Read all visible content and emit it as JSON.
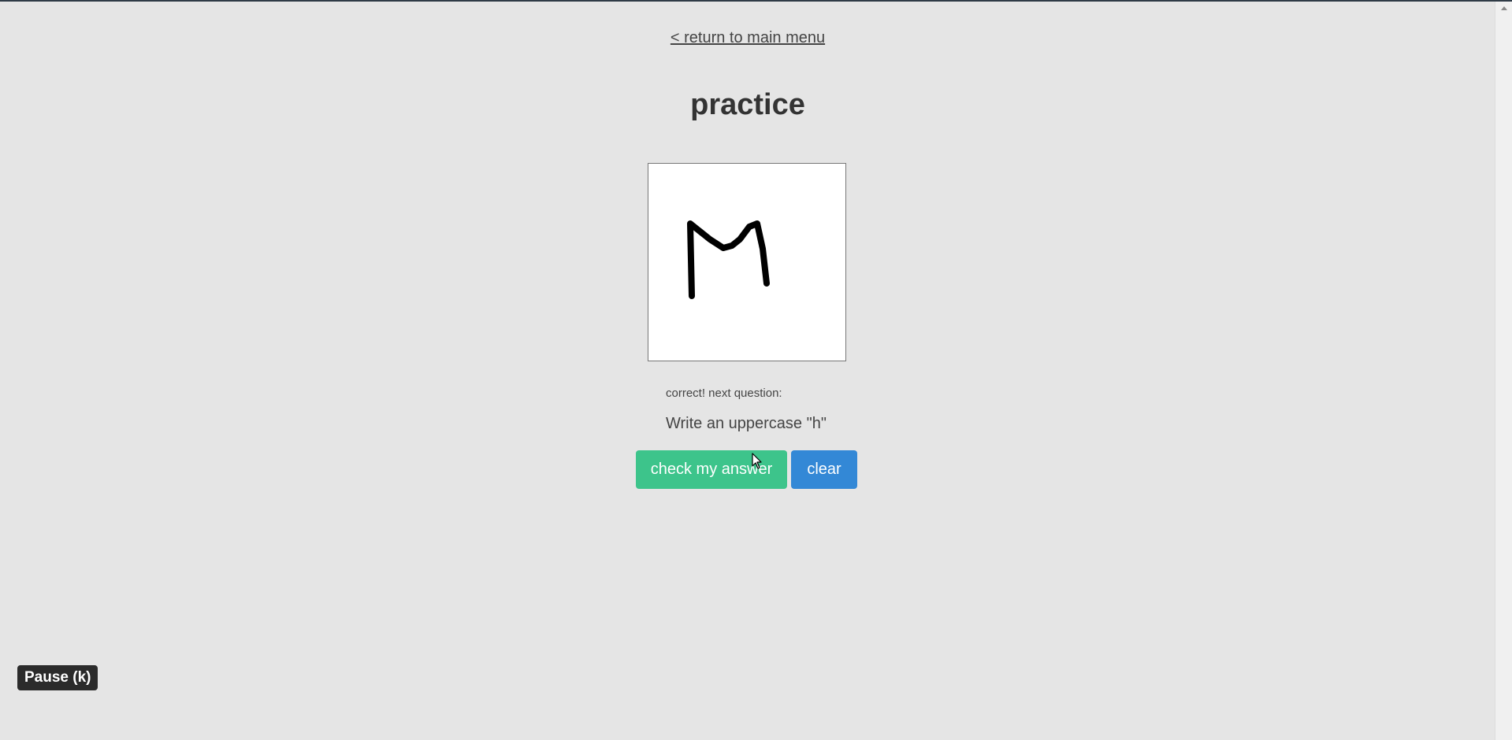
{
  "nav": {
    "back_label": "< return to main menu"
  },
  "page": {
    "title": "practice"
  },
  "drawing_canvas": {
    "drawn_letter": "M",
    "stroke_color": "#000000",
    "background": "#ffffff"
  },
  "feedback": {
    "message": "correct! next question:"
  },
  "question": {
    "prompt": "Write an uppercase \"h\""
  },
  "buttons": {
    "check_label": "check my answer",
    "check_color": "#3dc48b",
    "clear_label": "clear",
    "clear_color": "#3388d6"
  },
  "tooltip": {
    "pause_label": "Pause (k)"
  },
  "icons": {
    "cursor": "arrow-cursor-icon",
    "scroll_up": "scroll-up-arrow-icon"
  }
}
